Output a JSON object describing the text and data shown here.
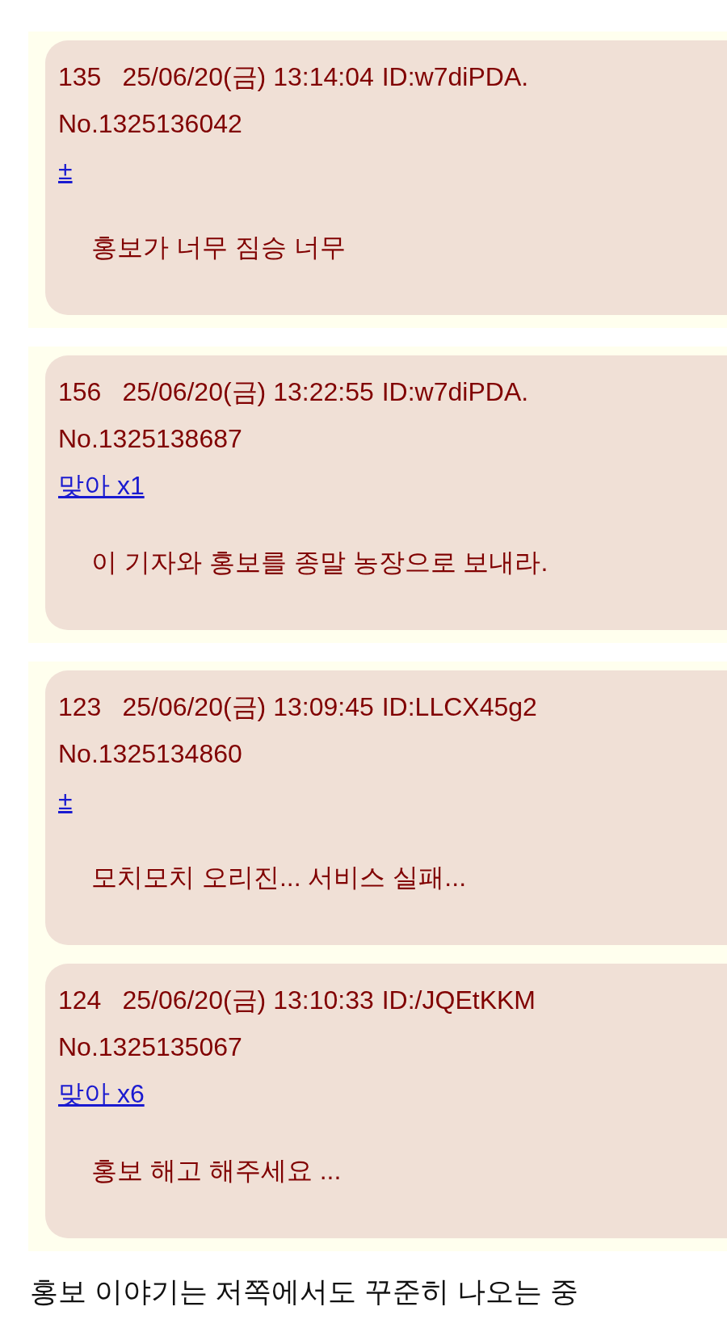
{
  "groups": [
    {
      "posts": [
        {
          "number": "135",
          "datetime": "25/06/20(금) 13:14:04",
          "id": "ID:w7diPDA.",
          "post_no": "No.1325136042",
          "link": "±",
          "message": "홍보가 너무 짐승 너무"
        }
      ]
    },
    {
      "posts": [
        {
          "number": "156",
          "datetime": "25/06/20(금) 13:22:55",
          "id": "ID:w7diPDA.",
          "post_no": "No.1325138687",
          "link": "맞아 x1",
          "message": "이 기자와 홍보를 종말 농장으로 보내라."
        }
      ]
    },
    {
      "posts": [
        {
          "number": "123",
          "datetime": "25/06/20(금) 13:09:45",
          "id": "ID:LLCX45g2",
          "post_no": "No.1325134860",
          "link": "±",
          "message": "모치모치 오리진... 서비스 실패..."
        },
        {
          "number": "124",
          "datetime": "25/06/20(금) 13:10:33",
          "id": "ID:/JQEtKKM",
          "post_no": "No.1325135067",
          "link": "맞아 x6",
          "message": "홍보 해고 해주세요 ..."
        }
      ]
    }
  ],
  "caption": "홍보 이야기는 저쪽에서도 꾸준히 나오는 중"
}
